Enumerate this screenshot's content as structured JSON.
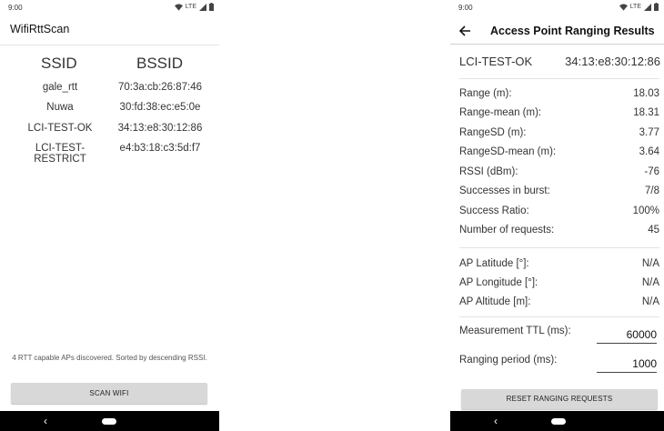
{
  "left": {
    "status": {
      "time": "9:00",
      "network": "LTE"
    },
    "app_title": "WifiRttScan",
    "columns": {
      "ssid": "SSID",
      "bssid": "BSSID"
    },
    "access_points": [
      {
        "ssid": "gale_rtt",
        "bssid": "70:3a:cb:26:87:46"
      },
      {
        "ssid": "Nuwa",
        "bssid": "30:fd:38:ec:e5:0e"
      },
      {
        "ssid": "LCI-TEST-OK",
        "bssid": "34:13:e8:30:12:86"
      },
      {
        "ssid": "LCI-TEST-RESTRICT",
        "bssid": "e4:b3:18:c3:5d:f7"
      }
    ],
    "footer_note": "4 RTT capable APs discovered. Sorted by descending RSSI.",
    "scan_button": "SCAN WIFI",
    "nav": {
      "back": "‹"
    }
  },
  "right": {
    "status": {
      "time": "9:00",
      "network": "LTE"
    },
    "title": "Access Point Ranging Results",
    "ap": {
      "ssid": "LCI-TEST-OK",
      "bssid": "34:13:e8:30:12:86"
    },
    "stats": [
      {
        "label": "Range (m):",
        "value": "18.03"
      },
      {
        "label": "Range-mean (m):",
        "value": "18.31"
      },
      {
        "label": "RangeSD (m):",
        "value": "3.77"
      },
      {
        "label": "RangeSD-mean (m):",
        "value": "3.64"
      },
      {
        "label": "RSSI (dBm):",
        "value": "-76"
      },
      {
        "label": "Successes in burst:",
        "value": "7/8"
      },
      {
        "label": "Success Ratio:",
        "value": "100%"
      },
      {
        "label": "Number of requests:",
        "value": "45"
      }
    ],
    "location": [
      {
        "label": "AP Latitude [°]:",
        "value": "N/A"
      },
      {
        "label": "AP Longitude [°]:",
        "value": "N/A"
      },
      {
        "label": "AP Altitude [m]:",
        "value": "N/A"
      }
    ],
    "measurement_ttl": {
      "label": "Measurement TTL (ms):",
      "value": "60000"
    },
    "ranging_period": {
      "label": "Ranging period (ms):",
      "value": "1000"
    },
    "reset_button": "RESET RANGING REQUESTS",
    "nav": {
      "back": "‹"
    }
  }
}
